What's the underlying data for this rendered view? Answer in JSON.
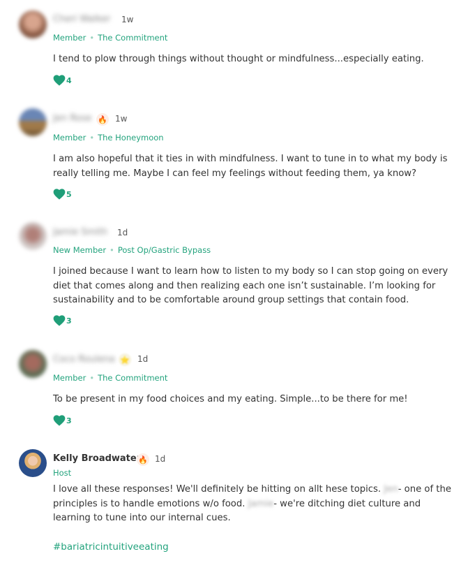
{
  "comments": [
    {
      "name": "Cheri Walker",
      "time": "1w",
      "role": "Member",
      "group": "The Commitment",
      "text": "I tend to plow through things without thought or mindfulness...especially eating.",
      "likes": "4"
    },
    {
      "name": "Jen Rose",
      "badge": "fire-icon",
      "time": "1w",
      "role": "Member",
      "group": "The Honeymoon",
      "text": "I am also hopeful that it ties in with mindfulness. I want to tune in to what my body is really telling me. Maybe I can feel my feelings without feeding them, ya know?",
      "likes": "5"
    },
    {
      "name": "Jamie Smith",
      "time": "1d",
      "role": "New Member",
      "group": "Post Op/Gastric Bypass",
      "text": "I joined because I want to learn how to listen to my body so I can stop going on every diet that comes along and then realizing each one isn’t sustainable. I’m looking for sustainability and to be comfortable around group settings that contain food.",
      "likes": "3"
    },
    {
      "name": "Coco Roulena",
      "badge": "star-icon",
      "time": "1d",
      "role": "Member",
      "group": "The Commitment",
      "text": "To be present in my food choices and my eating. Simple...to be there for me!",
      "likes": "3"
    },
    {
      "name": "Kelly Broadwater",
      "badge": "fire-icon",
      "time": "1d",
      "role": "Host",
      "text_a": "I love all these responses! We'll definitely be hitting on allt hese topics.",
      "mention_1": "Jen",
      "text_b": "- one of the principles is to handle emotions w/o food.",
      "mention_2": "Jamie",
      "text_c": "- we're ditching diet culture and learning to tune into our internal cues.",
      "hashtag": "#bariatricintuitiveeating"
    }
  ],
  "colors": {
    "accent": "#23a37d",
    "heart": "#1f9e78"
  }
}
